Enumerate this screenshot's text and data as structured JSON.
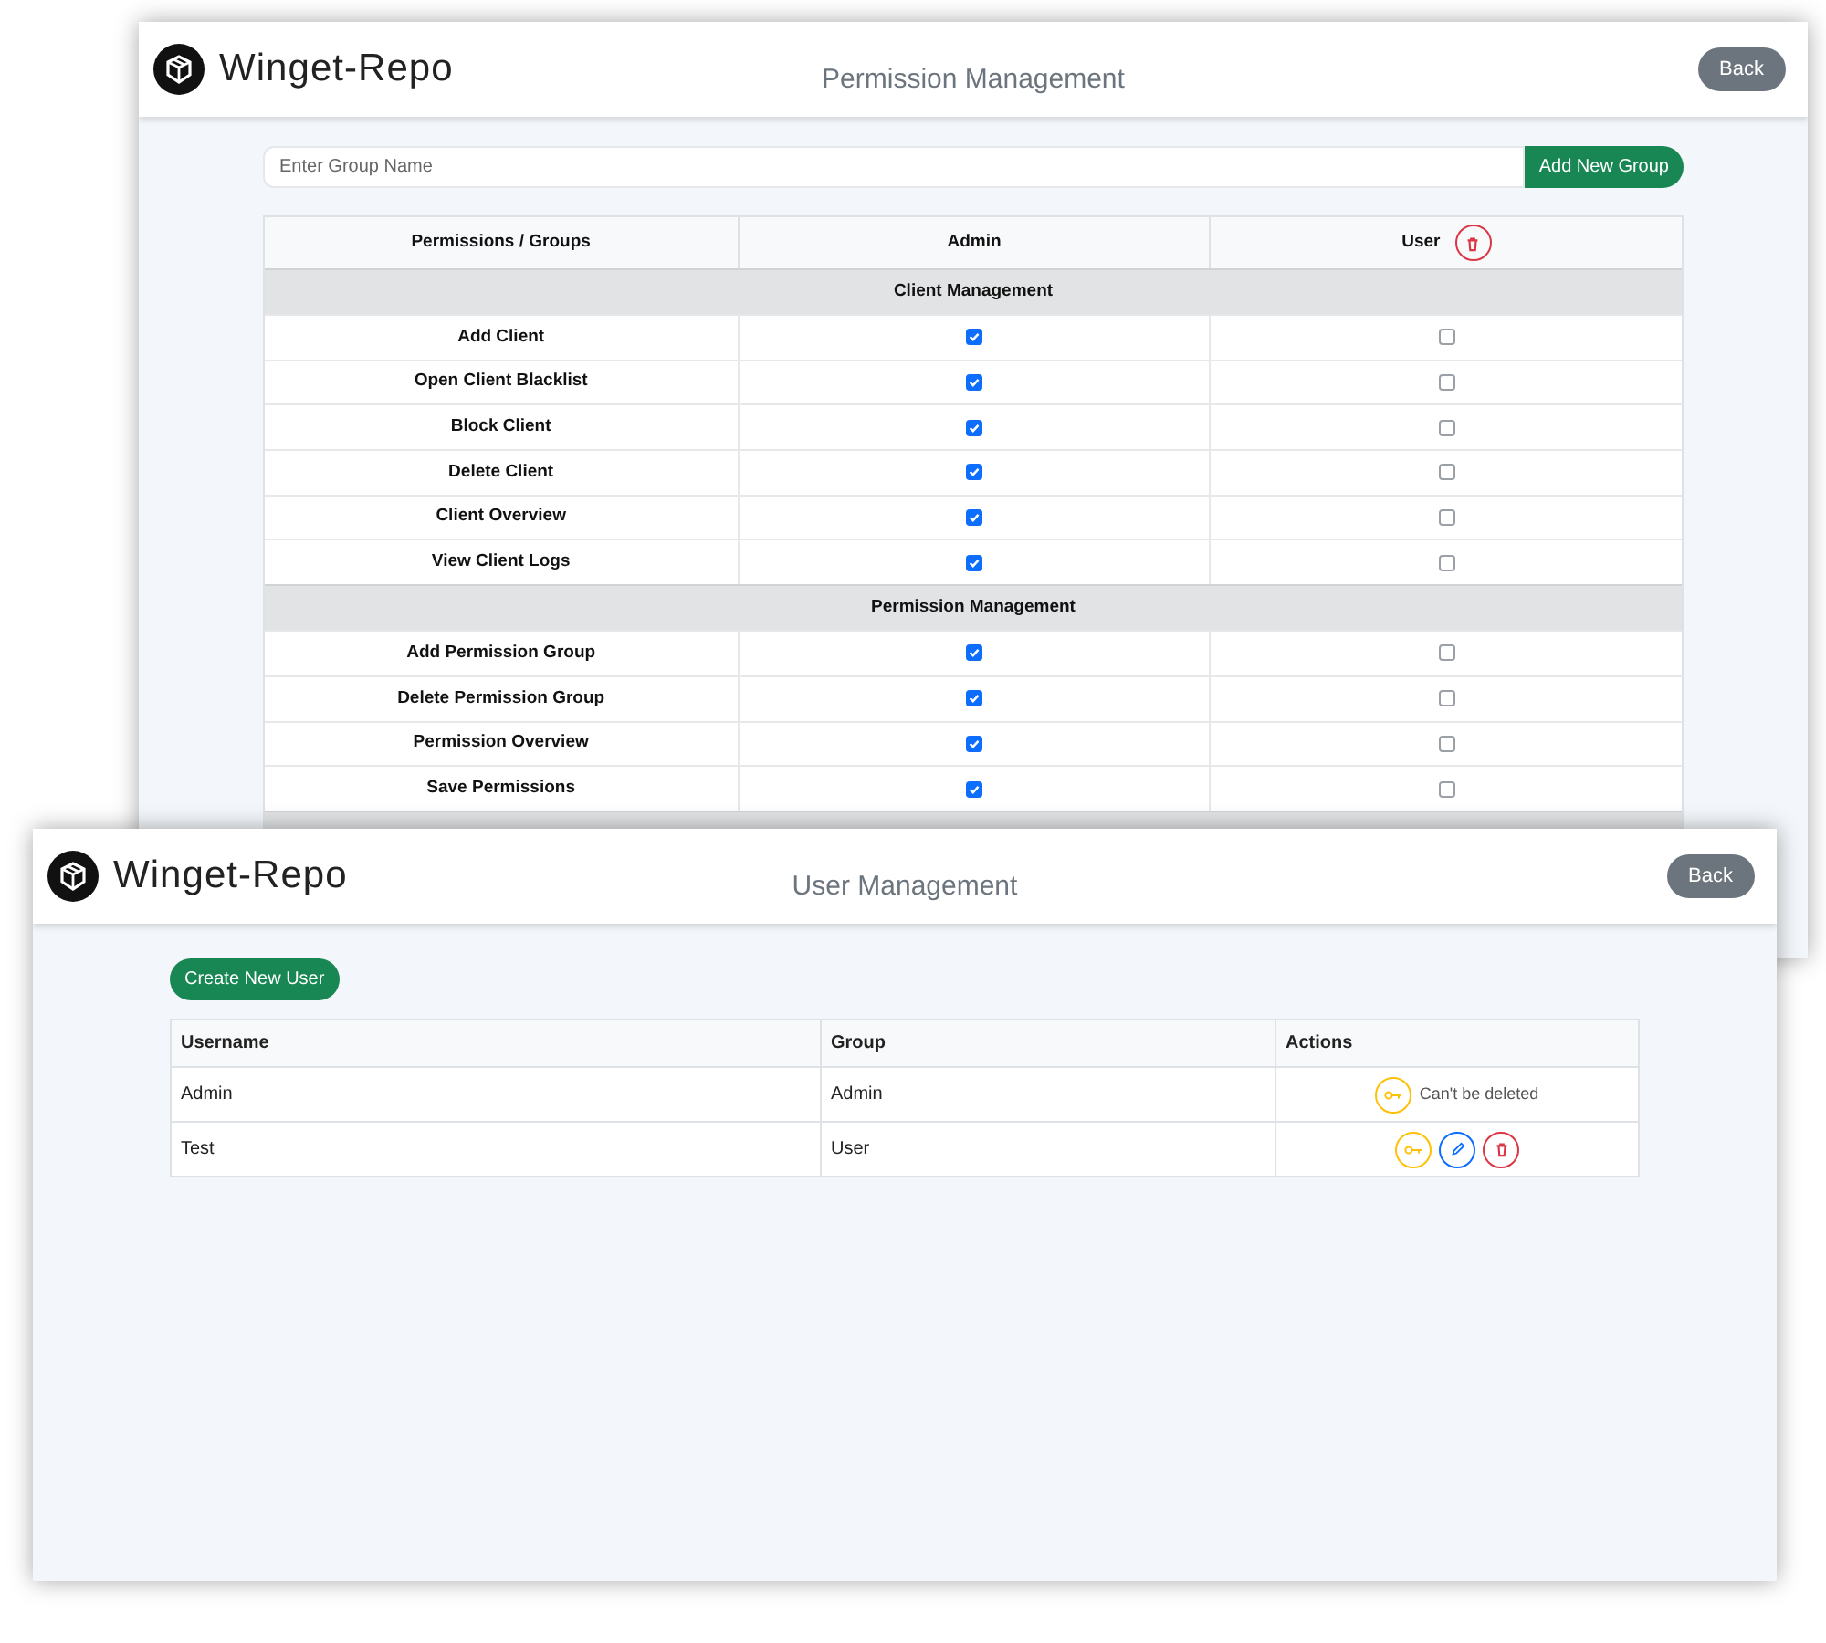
{
  "permission_window": {
    "brand": "Winget-Repo",
    "title": "Permission Management",
    "back_button": "Back",
    "group_name_field": {
      "placeholder": "Enter Group Name"
    },
    "add_button": "Add New Group",
    "columns": [
      {
        "label": "Permissions / Groups"
      },
      {
        "label": "Admin",
        "deletable": false
      },
      {
        "label": "User",
        "deletable": true
      }
    ],
    "sections": [
      {
        "title": "Client Management",
        "rows": [
          {
            "label": "Add Client",
            "checked": [
              true,
              false
            ]
          },
          {
            "label": "Open Client Blacklist",
            "checked": [
              true,
              false
            ]
          },
          {
            "label": "Block Client",
            "checked": [
              true,
              false
            ]
          },
          {
            "label": "Delete Client",
            "checked": [
              true,
              false
            ]
          },
          {
            "label": "Client Overview",
            "checked": [
              true,
              false
            ]
          },
          {
            "label": "View Client Logs",
            "checked": [
              true,
              false
            ]
          }
        ]
      },
      {
        "title": "Permission Management",
        "rows": [
          {
            "label": "Add Permission Group",
            "checked": [
              true,
              false
            ]
          },
          {
            "label": "Delete Permission Group",
            "checked": [
              true,
              false
            ]
          },
          {
            "label": "Permission Overview",
            "checked": [
              true,
              false
            ]
          },
          {
            "label": "Save Permissions",
            "checked": [
              true,
              false
            ]
          }
        ]
      }
    ]
  },
  "user_window": {
    "brand": "Winget-Repo",
    "title": "User Management",
    "back_button": "Back",
    "create_button": "Create New User",
    "columns": [
      "Username",
      "Group",
      "Actions"
    ],
    "rows": [
      {
        "username": "Admin",
        "group": "Admin",
        "actions": [
          {
            "kind": "key"
          },
          {
            "kind": "note",
            "text": "Can't be deleted"
          }
        ]
      },
      {
        "username": "Test",
        "group": "User",
        "actions": [
          {
            "kind": "key"
          },
          {
            "kind": "edit"
          },
          {
            "kind": "delete"
          }
        ]
      }
    ]
  }
}
